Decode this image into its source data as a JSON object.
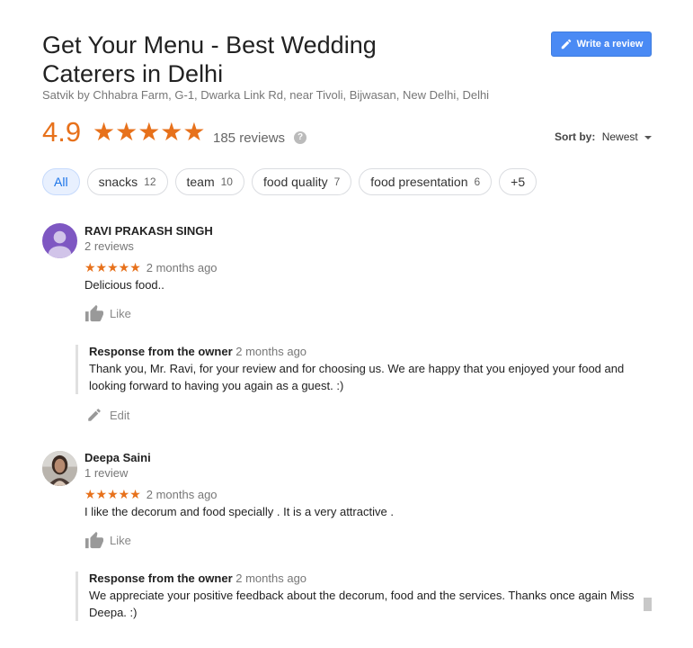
{
  "header": {
    "title": "Get Your Menu - Best Wedding Caterers in Delhi",
    "address": "Satvik by Chhabra Farm, G-1, Dwarka Link Rd, near Tivoli, Bijwasan, New Delhi, Delhi",
    "write_review_label": "Write a review"
  },
  "rating": {
    "value": "4.9",
    "stars": "★★★★★",
    "star_count": 5,
    "reviews_label": "185 reviews",
    "help": "?"
  },
  "sort": {
    "label": "Sort by:",
    "selected": "Newest"
  },
  "chips": [
    {
      "label": "All",
      "count": ""
    },
    {
      "label": "snacks",
      "count": "12"
    },
    {
      "label": "team",
      "count": "10"
    },
    {
      "label": "food quality",
      "count": "7"
    },
    {
      "label": "food presentation",
      "count": "6"
    },
    {
      "label": "+5",
      "count": ""
    }
  ],
  "reviews": [
    {
      "name": "RAVI PRAKASH SINGH",
      "sub": "2 reviews",
      "stars": "★★★★★",
      "rating": 5,
      "time": "2 months ago",
      "text": "Delicious food..",
      "like_label": "Like",
      "owner_label": "Response from the owner",
      "owner_time": "2 months ago",
      "owner_text": "Thank you, Mr. Ravi, for your review and for choosing us. We are happy that you enjoyed your food and looking forward to having you again as a guest. :)",
      "edit_label": "Edit"
    },
    {
      "name": "Deepa Saini",
      "sub": "1 review",
      "stars": "★★★★★",
      "rating": 5,
      "time": "2 months ago",
      "text": "I like the decorum and food specially . It is a very attractive .",
      "like_label": "Like",
      "owner_label": "Response from the owner",
      "owner_time": "2 months ago",
      "owner_text": "We appreciate your positive feedback about the decorum, food and the services. Thanks once again Miss Deepa. :)"
    }
  ],
  "colors": {
    "accent_star": "#e7711b",
    "button_blue": "#4a8af4",
    "avatar_purple": "#7e57c2"
  }
}
